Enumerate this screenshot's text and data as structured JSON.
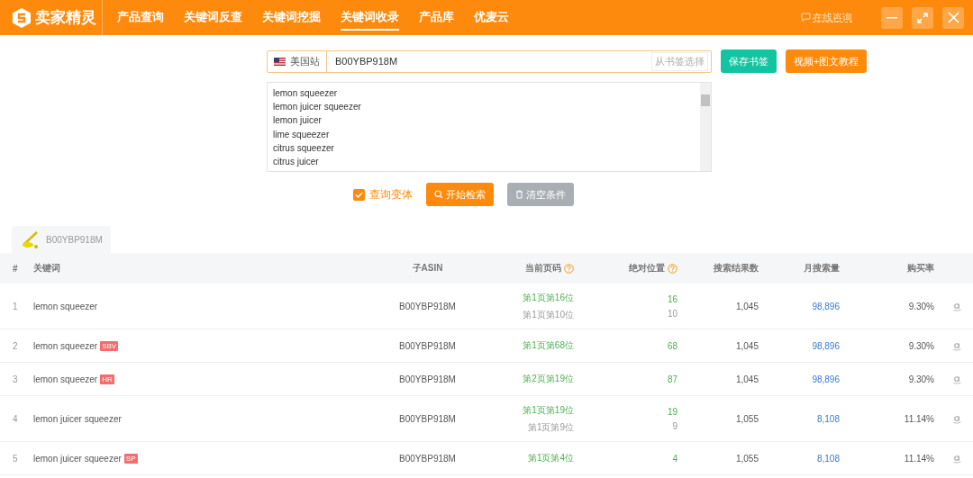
{
  "header": {
    "brand": "卖家精灵",
    "nav": [
      {
        "label": "产品查询",
        "selected": false
      },
      {
        "label": "关键词反查",
        "selected": false
      },
      {
        "label": "关键词挖掘",
        "selected": false
      },
      {
        "label": "关键词收录",
        "selected": true
      },
      {
        "label": "产品库",
        "selected": false
      },
      {
        "label": "优麦云",
        "selected": false
      }
    ],
    "consult": "在线咨询"
  },
  "search": {
    "marketplace": "美国站",
    "value": "B00YBP918M",
    "bookmark_pick": "从书签选择",
    "save_button": "保存书签",
    "tutorial_button": "视频+图文教程"
  },
  "keywords": [
    "lemon squeezer",
    "lemon juicer squeezer",
    "lemon juicer",
    "lime squeezer",
    "citrus squeezer",
    "citrus juicer"
  ],
  "variant": {
    "label": "查询变体",
    "checked": true
  },
  "start_button": "开始检索",
  "clear_button": {
    "label": "清空条件",
    "disabled": true
  },
  "product_tab": {
    "asin": "B00YBP918M"
  },
  "table": {
    "columns": [
      "#",
      "关键词",
      "子ASIN",
      "当前页码",
      "绝对位置",
      "搜索结果数",
      "月搜索量",
      "购买率"
    ],
    "rows": [
      {
        "index": "1",
        "keyword": "lemon squeezer",
        "asin": "B00YBP918M",
        "positions": [
          {
            "kind": "organic",
            "page": "第1页第16位",
            "absolute": "16"
          },
          {
            "kind": "previous",
            "page": "第1页第10位",
            "absolute": "10"
          }
        ],
        "results": "1,045",
        "monthly": "98,896",
        "rate": "9.30%"
      },
      {
        "index": "2",
        "keyword": "lemon squeezer",
        "badge": "SBV",
        "asin": "B00YBP918M",
        "positions": [
          {
            "kind": "organic",
            "page": "第1页第68位",
            "absolute": "68"
          }
        ],
        "results": "1,045",
        "monthly": "98,896",
        "rate": "9.30%"
      },
      {
        "index": "3",
        "keyword": "lemon squeezer",
        "badge": "HR",
        "asin": "B00YBP918M",
        "positions": [
          {
            "kind": "organic",
            "page": "第2页第19位",
            "absolute": "87"
          }
        ],
        "results": "1,045",
        "monthly": "98,896",
        "rate": "9.30%"
      },
      {
        "index": "4",
        "keyword": "lemon juicer squeezer",
        "asin": "B00YBP918M",
        "positions": [
          {
            "kind": "organic",
            "page": "第1页第19位",
            "absolute": "19"
          },
          {
            "kind": "previous",
            "page": "第1页第9位",
            "absolute": "9"
          }
        ],
        "results": "1,055",
        "monthly": "8,108",
        "rate": "11.14%"
      },
      {
        "index": "5",
        "keyword": "lemon juicer squeezer",
        "badge": "SP",
        "asin": "B00YBP918M",
        "positions": [
          {
            "kind": "organic",
            "page": "第1页第4位",
            "absolute": "4"
          }
        ],
        "results": "1,055",
        "monthly": "8,108",
        "rate": "11.14%"
      }
    ]
  }
}
